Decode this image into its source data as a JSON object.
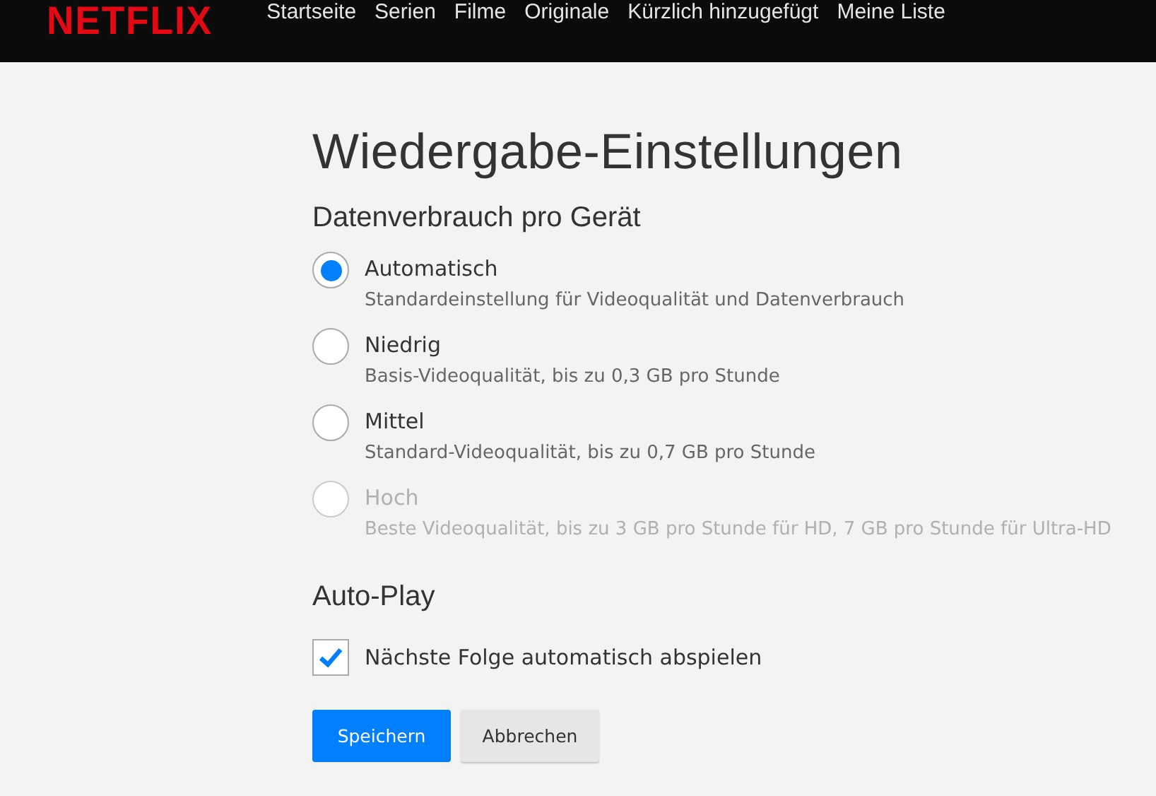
{
  "header": {
    "logo": "NETFLIX",
    "nav": [
      {
        "label": "Startseite"
      },
      {
        "label": "Serien"
      },
      {
        "label": "Filme"
      },
      {
        "label": "Originale"
      },
      {
        "label": "Kürzlich hinzugefügt"
      },
      {
        "label": "Meine Liste"
      }
    ]
  },
  "title": "Wiedergabe-Einstellungen",
  "data_usage": {
    "heading": "Datenverbrauch pro Gerät",
    "options": [
      {
        "label": "Automatisch",
        "description": "Standardeinstellung für Videoqualität und Datenverbrauch",
        "selected": true,
        "disabled": false
      },
      {
        "label": "Niedrig",
        "description": "Basis-Videoqualität, bis zu 0,3 GB pro Stunde",
        "selected": false,
        "disabled": false
      },
      {
        "label": "Mittel",
        "description": "Standard-Videoqualität, bis zu 0,7 GB pro Stunde",
        "selected": false,
        "disabled": false
      },
      {
        "label": "Hoch",
        "description": "Beste Videoqualität, bis zu 3 GB pro Stunde für HD, 7 GB pro Stunde für Ultra-HD",
        "selected": false,
        "disabled": true
      }
    ]
  },
  "autoplay": {
    "heading": "Auto-Play",
    "checkbox": {
      "label": "Nächste Folge automatisch abspielen",
      "checked": true
    }
  },
  "buttons": [
    {
      "label": "Speichern",
      "kind": "primary"
    },
    {
      "label": "Abbrechen",
      "kind": "secondary"
    }
  ]
}
